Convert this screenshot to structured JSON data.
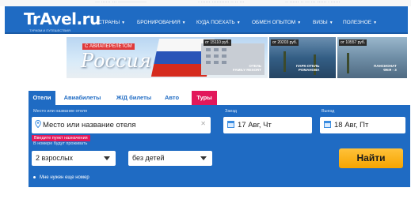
{
  "top_strip": [
    "··· ······ ··· ··················",
    "· ······ ··········· ·· ·· ···",
    "·· ······ ·· ··· ··· ······ · ······"
  ],
  "header": {
    "logo": "TrAvel.ru",
    "logo_tagline": "ТУРИЗМ И ПУТЕШЕСТВИЯ",
    "nav": [
      {
        "label": "СТРАНЫ"
      },
      {
        "label": "БРОНИРОВАНИЯ"
      },
      {
        "label": "КУДА ПОЕХАТЬ"
      },
      {
        "label": "ОБМЕН ОПЫТОМ"
      },
      {
        "label": "ВИЗЫ"
      },
      {
        "label": "ПОЛЕЗНОЕ"
      }
    ]
  },
  "banner": {
    "tagline": "С АВИАПЕРЕЛЁТОМ",
    "title": "Россия",
    "cards": [
      {
        "price": "от 15110 руб.",
        "caption": "ОТЕЛЬ\nFAMILY RESORT"
      },
      {
        "price": "от 20203 руб.",
        "caption": "ПАРК-ОТЕЛЬ\nРОМАНОВА"
      },
      {
        "price": "от 10557 руб.",
        "caption": "ПАНСИОНАТ\nФЕЯ - 3"
      }
    ]
  },
  "tabs": [
    {
      "label": "Отели",
      "state": "active"
    },
    {
      "label": "Авиабилеты",
      "state": "normal"
    },
    {
      "label": "Ж/Д билеты",
      "state": "normal"
    },
    {
      "label": "Авто",
      "state": "normal"
    },
    {
      "label": "Туры",
      "state": "highlight"
    }
  ],
  "form": {
    "place_label": "Место или название отеля",
    "place_placeholder": "Место или название отеля",
    "place_error": "Введите пункт назначения",
    "guests_label": "В номере будут проживать",
    "checkin_label": "Заезд",
    "checkin_value": "17 Авг, Чт",
    "checkout_label": "Выезд",
    "checkout_value": "18 Авг, Пт",
    "adults_value": "2 взрослых",
    "children_value": "без детей",
    "search_button": "Найти",
    "more_rooms": "Мне нужен еще номер"
  },
  "colors": {
    "brand_blue": "#1f6bc3",
    "accent_pink": "#e2185b",
    "button_orange": "#f5a400"
  }
}
